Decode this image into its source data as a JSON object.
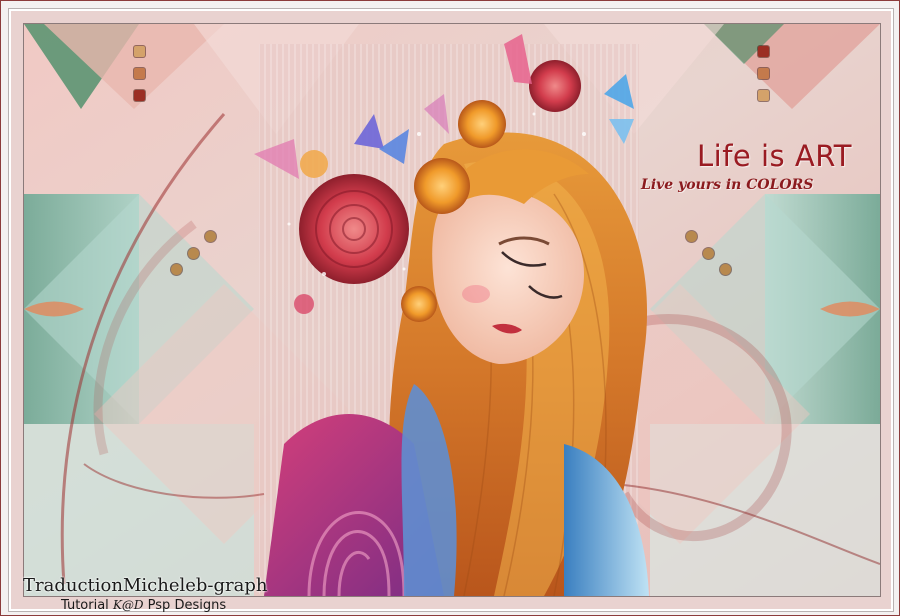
{
  "artwork": {
    "title": "Life is ART",
    "subtitle": "Live yours in COLORS"
  },
  "credits": {
    "line1": "TraductionMicheleb-graph",
    "line2": "Tutorial",
    "logo_text": "K@D",
    "line2_end": "Psp Designs"
  },
  "colors": {
    "title": "#9a1b22",
    "border": "#8c3b3b",
    "teal": "#7fb8a8",
    "pink": "#e7a6a3",
    "hair": "#d98a2b"
  }
}
